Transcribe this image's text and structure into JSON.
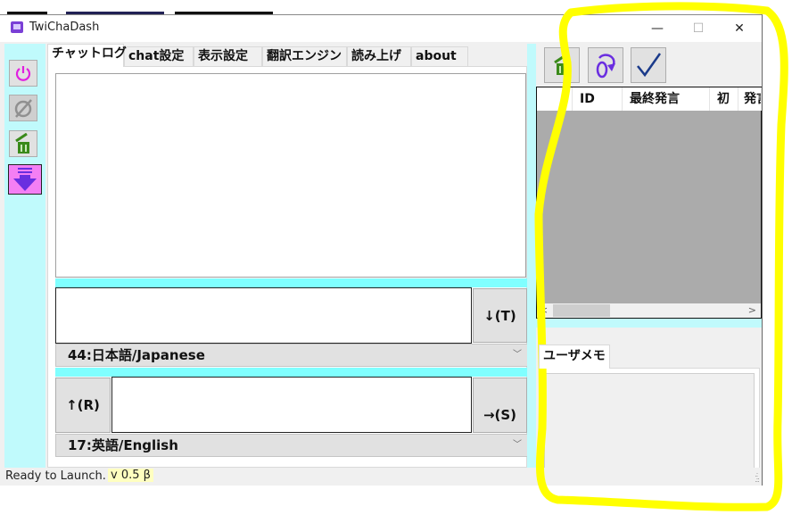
{
  "window": {
    "title": "TwiChaDash",
    "controls": {
      "minimize": "—",
      "maximize": "☐",
      "close": "✕"
    }
  },
  "left_toolbar": {
    "buttons": [
      {
        "name": "power",
        "icon": "power-icon",
        "color": "#e020e0"
      },
      {
        "name": "disconnect",
        "icon": "disconnect-icon",
        "color": "#909090"
      },
      {
        "name": "clear",
        "icon": "trash-icon",
        "color": "#3a8a1a"
      },
      {
        "name": "scroll-down",
        "icon": "arrow-down-icon",
        "color": "#6a2ee0",
        "background": "#f47ff4"
      }
    ]
  },
  "tabs": [
    {
      "label": "チャットログ",
      "active": true
    },
    {
      "label": "chat設定",
      "active": false
    },
    {
      "label": "表示設定",
      "active": false
    },
    {
      "label": "翻訳エンジン",
      "active": false
    },
    {
      "label": "読み上げ",
      "active": false
    },
    {
      "label": "about",
      "active": false
    }
  ],
  "chat": {
    "log_text": "",
    "translate_input_value": "",
    "translate_button": "↓(T)",
    "source_language": "44:日本語/Japanese",
    "reverse_button": "↑(R)",
    "send_input_value": "",
    "send_button": "→(S)",
    "target_language": "17:英語/English"
  },
  "right_toolbar": {
    "buttons": [
      {
        "name": "clear-users",
        "icon": "trash-icon"
      },
      {
        "name": "reload",
        "icon": "refresh-icon"
      },
      {
        "name": "confirm",
        "icon": "checkmark-icon"
      }
    ]
  },
  "user_grid": {
    "columns": [
      "",
      "ID",
      "最終発言",
      "初",
      "発言"
    ],
    "rows": []
  },
  "memo": {
    "tab_label": "ユーザメモ",
    "text": ""
  },
  "status": {
    "text": "Ready to Launch.",
    "version": "v 0.5 β"
  },
  "colors": {
    "rail_cyan": "#c0fafc",
    "band_cyan": "#80ffff",
    "annotation_yellow": "#ffff00"
  }
}
